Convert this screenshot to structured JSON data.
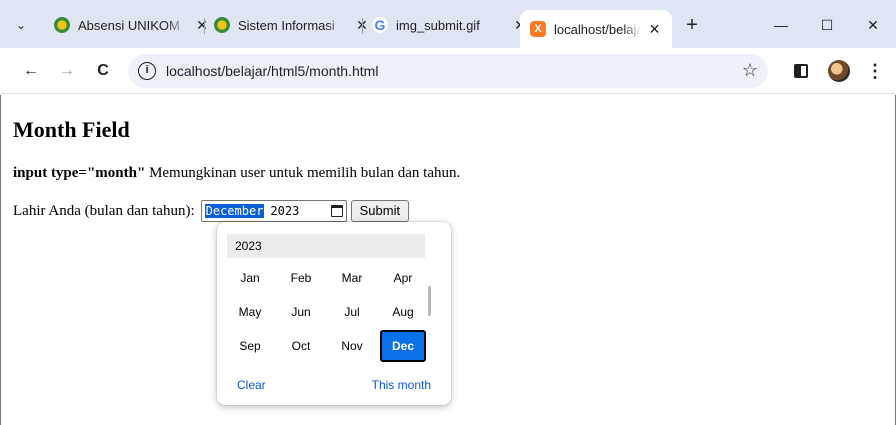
{
  "tabs": [
    {
      "title": "Absensi UNIKOM",
      "icon": "unikom-favicon-icon"
    },
    {
      "title": "Sistem Informasi",
      "icon": "unikom-favicon-icon"
    },
    {
      "title": "img_submit.gif",
      "icon": "google-favicon-icon"
    },
    {
      "title": "localhost/belajar",
      "icon": "xampp-favicon-icon",
      "active": true
    }
  ],
  "tab_close": "✕",
  "new_tab": "+",
  "window": {
    "minimize": "—",
    "maximize": "☐",
    "close": "✕"
  },
  "toolbar": {
    "back": "←",
    "forward": "→",
    "reload": "C",
    "url": "localhost/belajar/html5/month.html",
    "star": "☆",
    "menu": "⋮"
  },
  "page": {
    "heading": "Month Field",
    "desc_code": "input type=\"month\"",
    "desc_text": " Memungkinan user untuk memilih bulan dan tahun.",
    "form_label": "Lahir Anda (bulan dan tahun):",
    "month_value": "December",
    "year_value": "2023",
    "submit_label": "Submit"
  },
  "picker": {
    "year": "2023",
    "months": [
      "Jan",
      "Feb",
      "Mar",
      "Apr",
      "May",
      "Jun",
      "Jul",
      "Aug",
      "Sep",
      "Oct",
      "Nov",
      "Dec"
    ],
    "selected": "Dec",
    "clear_label": "Clear",
    "this_month_label": "This month"
  },
  "colors": {
    "accent": "#0b71e8",
    "link": "#0b57d0",
    "tabstrip": "#dfe5f2"
  }
}
